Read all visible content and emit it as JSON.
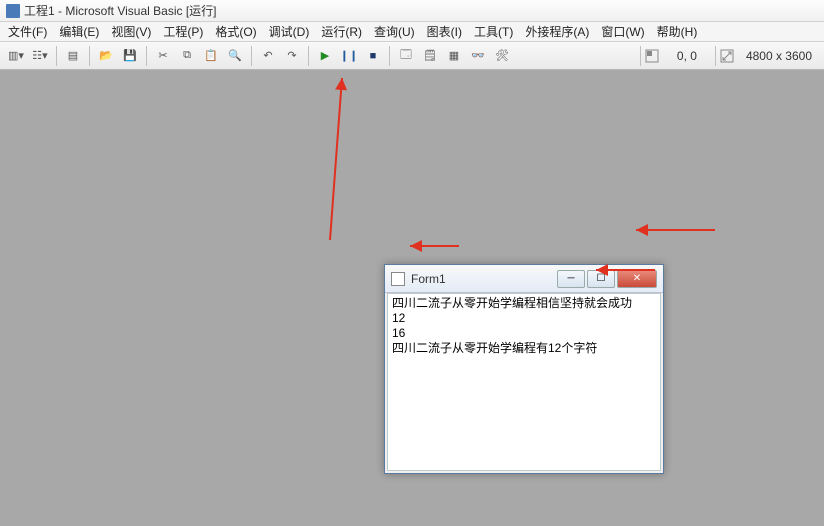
{
  "titlebar": {
    "text": "工程1 - Microsoft Visual Basic [运行]"
  },
  "menu": {
    "file": "文件(F)",
    "edit": "编辑(E)",
    "view": "视图(V)",
    "project": "工程(P)",
    "format": "格式(O)",
    "debug": "调试(D)",
    "run": "运行(R)",
    "query": "查询(U)",
    "diagram": "图表(I)",
    "tools": "工具(T)",
    "addins": "外接程序(A)",
    "window": "窗口(W)",
    "help": "帮助(H)"
  },
  "toolbar": {
    "coords": "0, 0",
    "size": "4800 x 3600"
  },
  "form": {
    "title": "Form1",
    "line1": "四川二流子从零开始学编程相信坚持就会成功",
    "line2": " 12",
    "line3": " 16",
    "line4": "四川二流子从零开始学编程有12个字符"
  }
}
